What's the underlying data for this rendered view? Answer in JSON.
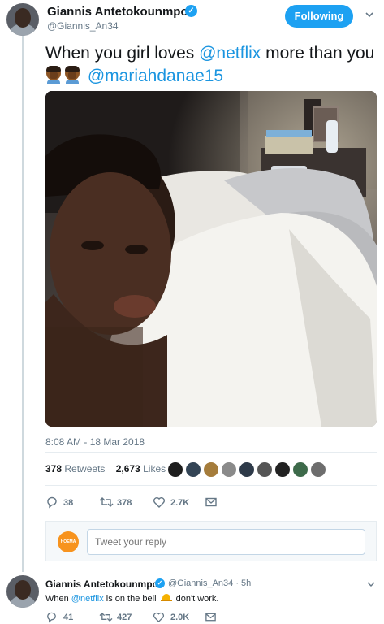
{
  "tweet": {
    "display_name": "Giannis Antetokounmpo",
    "handle": "@Giannis_An34",
    "follow_label": "Following",
    "text_1": "When you girl loves ",
    "mention_1": "@netflix",
    "text_2": " more than you ",
    "mention_2": "@mariahdanae15",
    "emoji": "facepalm (dark skin tone) ×2",
    "timestamp": "8:08 AM - 18 Mar 2018",
    "retweets_count": "378",
    "retweets_label": "Retweets",
    "likes_count": "2,673",
    "likes_label": "Likes",
    "actions": {
      "reply": "38",
      "retweet": "378",
      "like": "2.7K"
    }
  },
  "reply_box": {
    "placeholder": "Tweet your reply",
    "avatar_text": "HOEMA"
  },
  "reply_tweet": {
    "display_name": "Giannis Antetokounmpo",
    "handle_time": "@Giannis_An34 · 5h",
    "text_1": "When ",
    "mention": "@netflix",
    "text_2": " is on the bell ",
    "text_3": " don't work.",
    "actions": {
      "reply": "41",
      "retweet": "427",
      "like": "2.0K"
    }
  },
  "colors": {
    "accent": "#1da1f2",
    "mention": "#1b95e0",
    "muted": "#657786",
    "text": "#14171a"
  }
}
